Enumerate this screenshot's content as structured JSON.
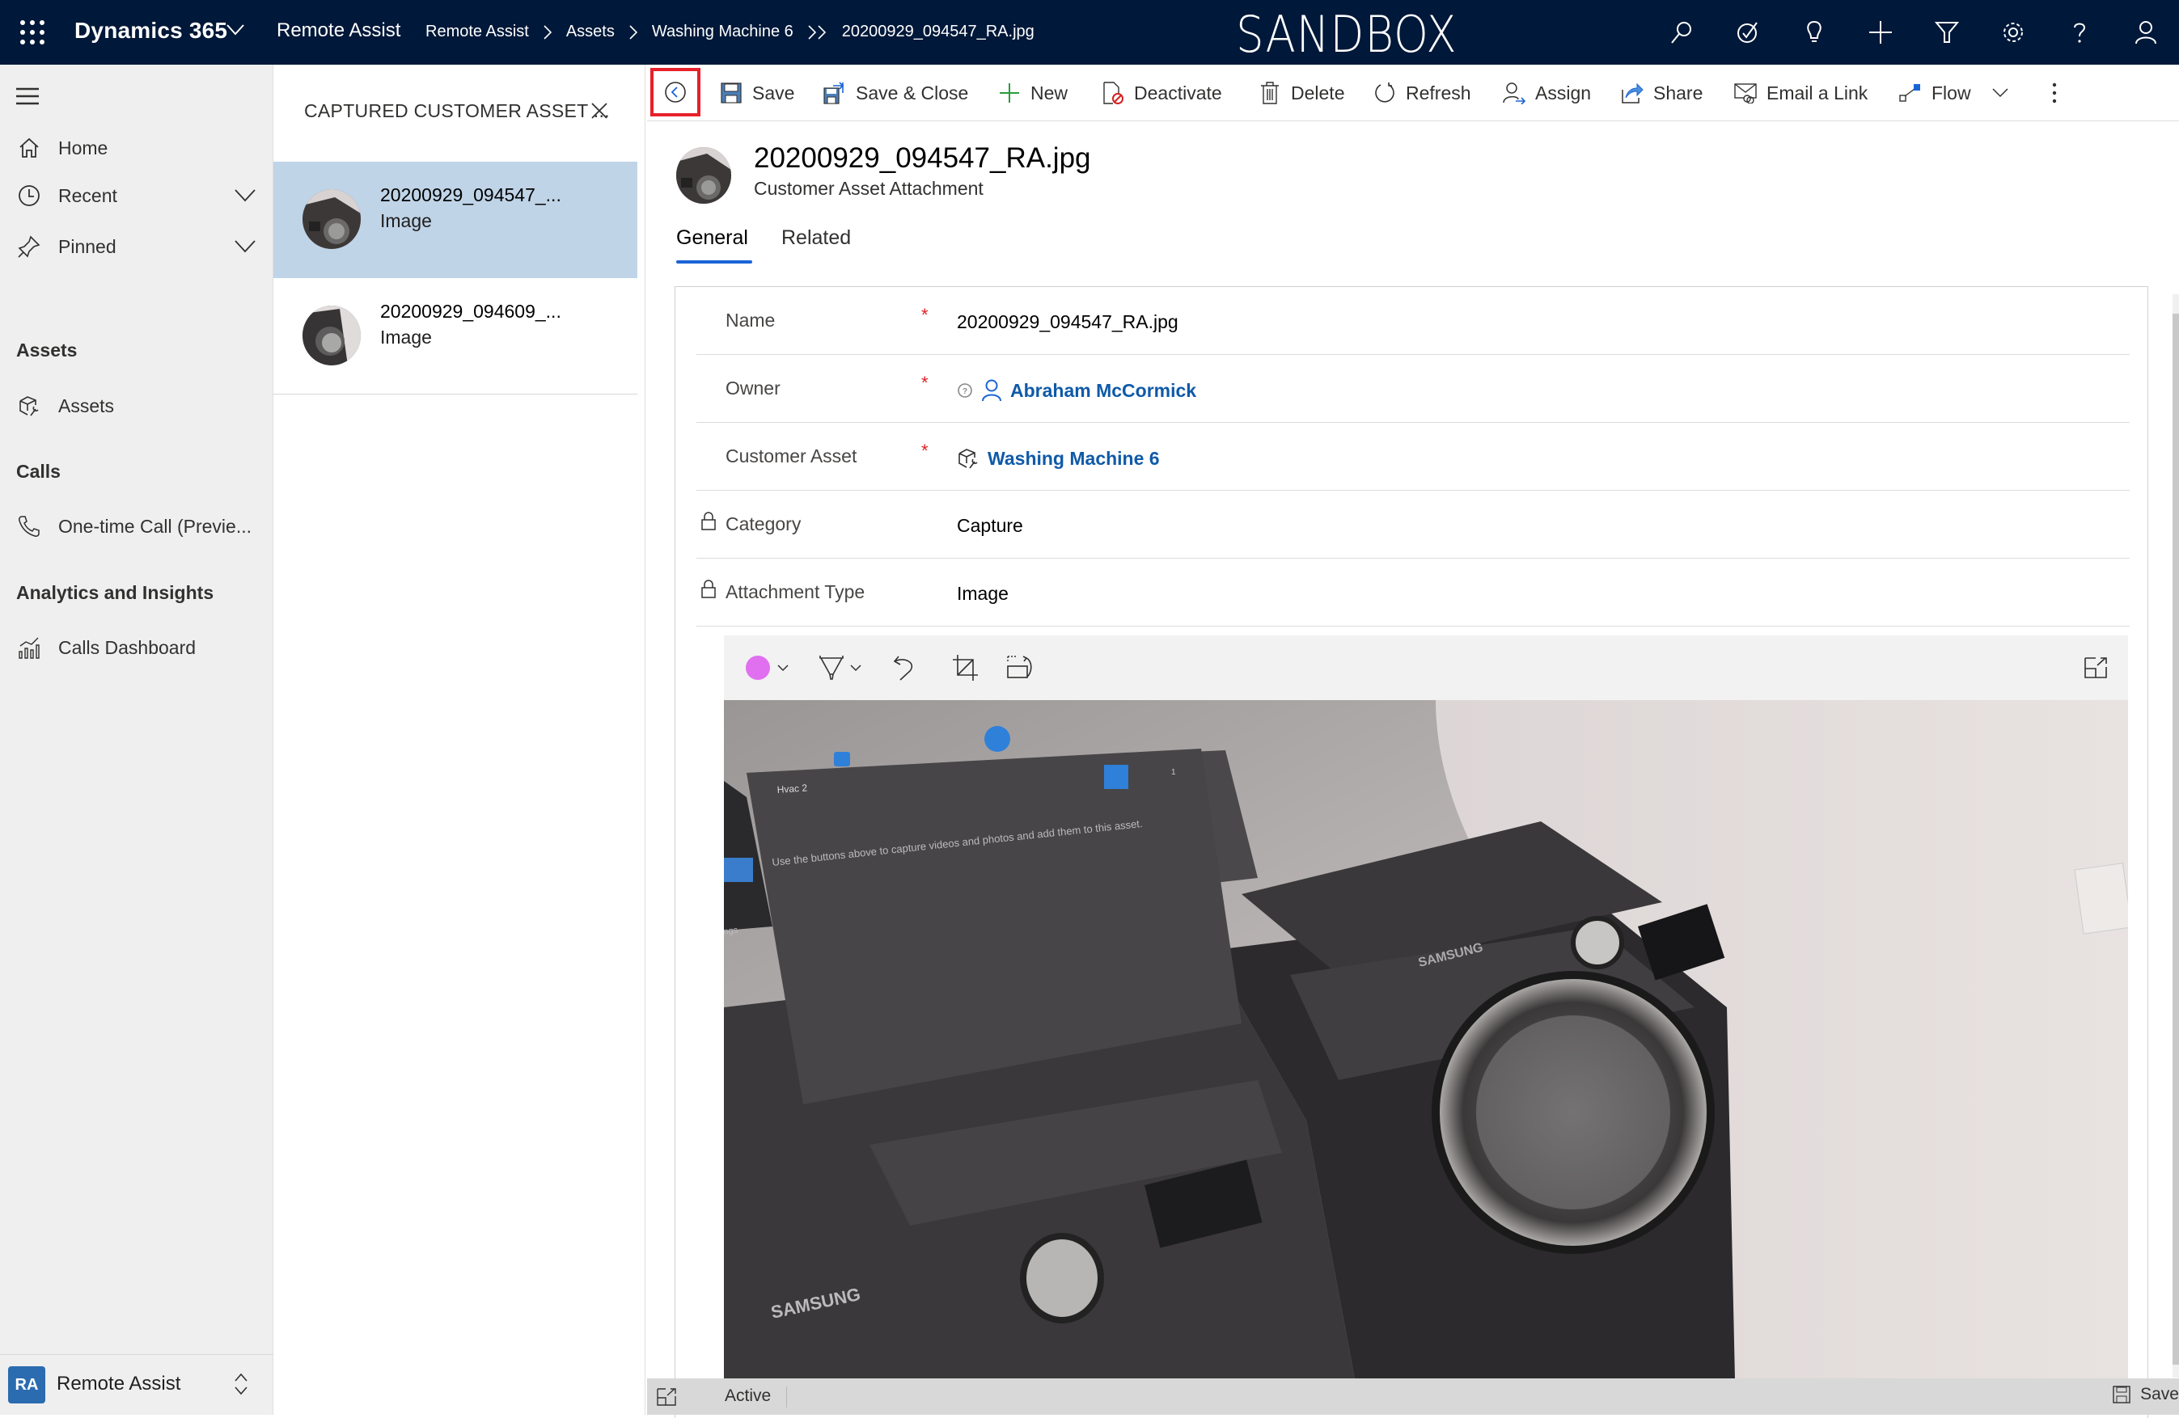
{
  "topbar": {
    "brand": "Dynamics 365",
    "app_name": "Remote Assist",
    "breadcrumb": [
      "Remote Assist",
      "Assets",
      "Washing Machine 6",
      "20200929_094547_RA.jpg"
    ],
    "environment_label": "SANDBOX",
    "icons": [
      "search-icon",
      "task-icon",
      "lightbulb-icon",
      "plus-icon",
      "filter-icon",
      "settings-icon",
      "help-icon",
      "user-icon"
    ]
  },
  "leftnav": {
    "items": [
      {
        "label": "Home",
        "icon": "home-icon"
      },
      {
        "label": "Recent",
        "icon": "clock-icon",
        "expandable": true
      },
      {
        "label": "Pinned",
        "icon": "pin-icon",
        "expandable": true
      }
    ],
    "groups": [
      {
        "title": "Assets",
        "items": [
          {
            "label": "Assets",
            "icon": "asset-icon"
          }
        ]
      },
      {
        "title": "Calls",
        "items": [
          {
            "label": "One-time Call (Previe...",
            "icon": "phone-icon"
          }
        ]
      },
      {
        "title": "Analytics and Insights",
        "items": [
          {
            "label": "Calls Dashboard",
            "icon": "dashboard-icon"
          }
        ]
      }
    ],
    "area": {
      "badge": "RA",
      "label": "Remote Assist",
      "badge_color": "#2b6bb0"
    }
  },
  "listpanel": {
    "title": "CAPTURED CUSTOMER ASSET ...",
    "records": [
      {
        "name": "20200929_094547_...",
        "type": "Image",
        "selected": true
      },
      {
        "name": "20200929_094609_...",
        "type": "Image",
        "selected": false
      }
    ]
  },
  "commandbar": {
    "back_label": "Back",
    "commands": [
      {
        "label": "Save",
        "icon": "save-icon"
      },
      {
        "label": "Save & Close",
        "icon": "save-close-icon"
      },
      {
        "label": "New",
        "icon": "plus-icon"
      },
      {
        "label": "Deactivate",
        "icon": "deactivate-icon"
      },
      {
        "label": "Delete",
        "icon": "delete-icon"
      },
      {
        "label": "Refresh",
        "icon": "refresh-icon"
      },
      {
        "label": "Assign",
        "icon": "assign-icon"
      },
      {
        "label": "Share",
        "icon": "share-icon"
      },
      {
        "label": "Email a Link",
        "icon": "email-link-icon"
      },
      {
        "label": "Flow",
        "icon": "flow-icon"
      }
    ]
  },
  "record": {
    "title": "20200929_094547_RA.jpg",
    "entity": "Customer Asset Attachment",
    "tabs": [
      {
        "label": "General",
        "active": true
      },
      {
        "label": "Related",
        "active": false
      }
    ],
    "fields": [
      {
        "label": "Name",
        "required": true,
        "locked": false,
        "value": "20200929_094547_RA.jpg",
        "type": "text"
      },
      {
        "label": "Owner",
        "required": true,
        "locked": false,
        "value": "Abraham McCormick",
        "type": "lookup-user"
      },
      {
        "label": "Customer Asset",
        "required": true,
        "locked": false,
        "value": "Washing Machine 6",
        "type": "lookup-asset"
      },
      {
        "label": "Category",
        "required": false,
        "locked": true,
        "value": "Capture",
        "type": "text"
      },
      {
        "label": "Attachment Type",
        "required": false,
        "locked": true,
        "value": "Image",
        "type": "text"
      }
    ]
  },
  "viewer": {
    "pen_color": "#e070f0",
    "tools": [
      "color-picker",
      "pen-tool",
      "undo",
      "crop",
      "rotate"
    ],
    "photo_overlay": {
      "panel_title": "Hvac 2",
      "message": "Use the buttons above to capture videos and photos and add them to this asset.",
      "page": "1",
      "side_text": "ngs",
      "brand_text": "SAMSUNG"
    }
  },
  "statusbar": {
    "status": "Active",
    "save_label": "Save"
  },
  "colors": {
    "topbar_bg": "#001839",
    "accent": "#1a64d6",
    "link": "#0f5aa8",
    "selected_row": "#c0d4e8",
    "required": "#e02020",
    "highlight_box": "#e8202a"
  }
}
